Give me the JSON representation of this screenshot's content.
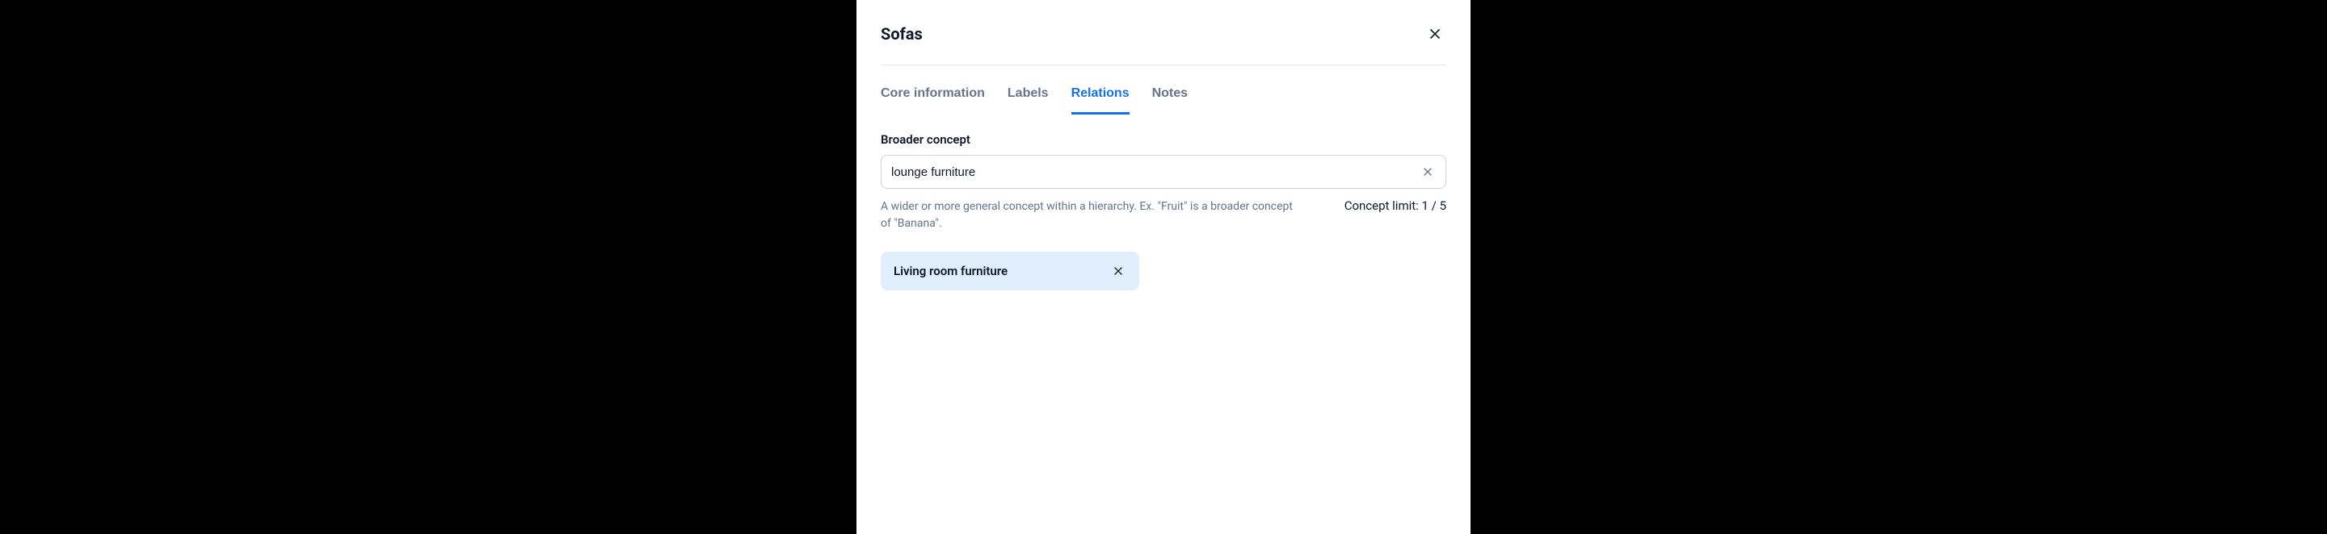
{
  "title": "Sofas",
  "tabs": [
    {
      "label": "Core information",
      "active": false
    },
    {
      "label": "Labels",
      "active": false
    },
    {
      "label": "Relations",
      "active": true
    },
    {
      "label": "Notes",
      "active": false
    }
  ],
  "broader": {
    "label": "Broader concept",
    "input_value": "lounge furniture",
    "helper": "A wider or more general concept within a hierarchy. Ex. \"Fruit\" is a broader concept of \"Banana\".",
    "limit": "Concept limit: 1 / 5",
    "chips": [
      {
        "label": "Living room furniture"
      }
    ]
  }
}
